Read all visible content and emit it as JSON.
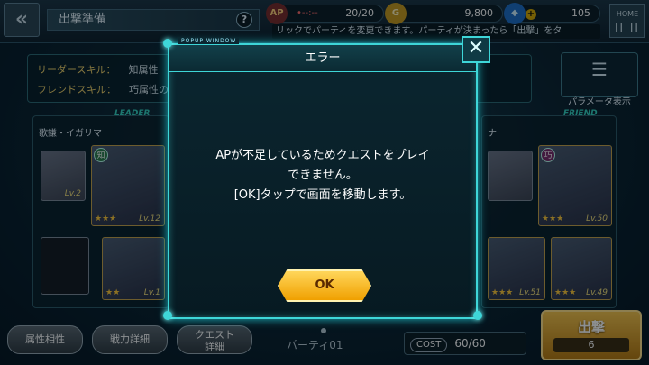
{
  "header": {
    "back_icon": "double-chevron-left-icon",
    "title": "出撃準備",
    "help": "?",
    "ap": {
      "dots": "•--:--",
      "value": "20/20"
    },
    "coins": "9,800",
    "gems": "105",
    "home": {
      "top": "HOME",
      "bottom": "II II"
    },
    "ticker": "リックでパーティを変更できます。パーティが決まったら「出撃」をタ"
  },
  "skills": {
    "leader_label": "リーダースキル：",
    "leader_value": "知属性",
    "friend_label": "フレンドスキル：",
    "friend_value": "巧属性の　　　　ATKを15%上昇"
  },
  "param_button": {
    "icon": "list-icon",
    "label": "パラメータ表示"
  },
  "slots": {
    "leader": {
      "tag": "LEADER",
      "name": "歌鎌・イガリマ",
      "attr": "知",
      "level": "Lv.12",
      "mini_label": "Lv.2",
      "sub_level": "Lv.1"
    },
    "friend": {
      "tag": "FRIEND",
      "name": "ナ",
      "attr": "巧",
      "level": "Lv.50",
      "sub1": "Lv.51",
      "sub2": "Lv.49"
    }
  },
  "bottom": {
    "affinity": "属性相性",
    "battle_detail": "戦力詳細",
    "quest_detail_1": "クエスト",
    "quest_detail_2": "詳細",
    "party": "パーティ01",
    "cost_label": "COST",
    "cost_value": "60/60",
    "sortie": "出撃",
    "sortie_count": "6"
  },
  "modal": {
    "popup_tag": "POPUP WINDOW",
    "title": "エラー",
    "message_1": "APが不足しているためクエストをプレイ",
    "message_2": "できません。",
    "message_3": "[OK]タップで画面を移動します。",
    "ok": "OK",
    "close_icon": "close-icon"
  },
  "colors": {
    "accent": "#3ed6d8",
    "ok": "#f0a000",
    "skill_label": "#f3d36b"
  }
}
